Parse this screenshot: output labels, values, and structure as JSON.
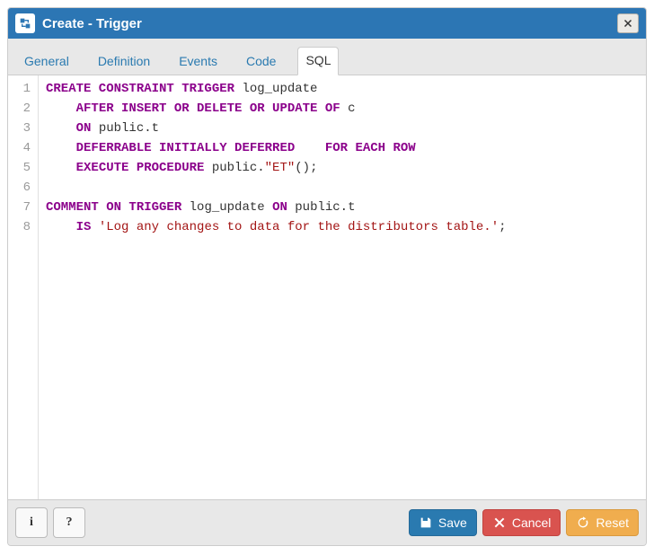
{
  "title": "Create - Trigger",
  "tabs": [
    {
      "label": "General"
    },
    {
      "label": "Definition"
    },
    {
      "label": "Events"
    },
    {
      "label": "Code"
    },
    {
      "label": "SQL",
      "active": true
    }
  ],
  "editor": {
    "language": "sql",
    "lines": [
      {
        "num": "1",
        "tokens": [
          {
            "t": "CREATE CONSTRAINT TRIGGER",
            "c": "kw"
          },
          {
            "t": " log_update",
            "c": "id"
          }
        ]
      },
      {
        "num": "2",
        "tokens": [
          {
            "t": "    ",
            "c": "id"
          },
          {
            "t": "AFTER INSERT OR DELETE OR UPDATE OF",
            "c": "kw"
          },
          {
            "t": " c",
            "c": "id"
          }
        ]
      },
      {
        "num": "3",
        "tokens": [
          {
            "t": "    ",
            "c": "id"
          },
          {
            "t": "ON",
            "c": "kw"
          },
          {
            "t": " public.t",
            "c": "id"
          }
        ]
      },
      {
        "num": "4",
        "tokens": [
          {
            "t": "    ",
            "c": "id"
          },
          {
            "t": "DEFERRABLE INITIALLY DEFERRED",
            "c": "kw"
          },
          {
            "t": "    ",
            "c": "id"
          },
          {
            "t": "FOR EACH ROW",
            "c": "kw"
          }
        ]
      },
      {
        "num": "5",
        "tokens": [
          {
            "t": "    ",
            "c": "id"
          },
          {
            "t": "EXECUTE PROCEDURE",
            "c": "kw"
          },
          {
            "t": " public.",
            "c": "id"
          },
          {
            "t": "\"ET\"",
            "c": "str"
          },
          {
            "t": "();",
            "c": "id"
          }
        ]
      },
      {
        "num": "6",
        "tokens": [
          {
            "t": "",
            "c": "id"
          }
        ]
      },
      {
        "num": "7",
        "tokens": [
          {
            "t": "COMMENT ON TRIGGER",
            "c": "kw"
          },
          {
            "t": " log_update ",
            "c": "id"
          },
          {
            "t": "ON",
            "c": "kw"
          },
          {
            "t": " public.t",
            "c": "id"
          }
        ]
      },
      {
        "num": "8",
        "tokens": [
          {
            "t": "    ",
            "c": "id"
          },
          {
            "t": "IS",
            "c": "kw"
          },
          {
            "t": " ",
            "c": "id"
          },
          {
            "t": "'Log any changes to data for the distributors table.'",
            "c": "str"
          },
          {
            "t": ";",
            "c": "id"
          }
        ]
      }
    ]
  },
  "footer": {
    "info_label": "i",
    "help_label": "?",
    "save_label": "Save",
    "cancel_label": "Cancel",
    "reset_label": "Reset"
  }
}
